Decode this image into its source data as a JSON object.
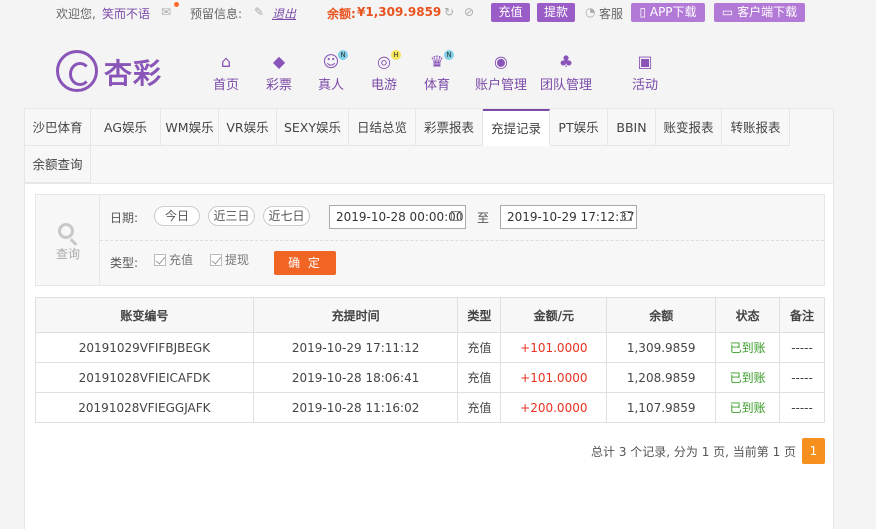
{
  "topbar": {
    "welcome": "欢迎您,",
    "username": "笑而不语",
    "reserved_info_label": "预留信息:",
    "logout": "退出",
    "balance_label": "余额:",
    "balance_value": "¥1,309.9859",
    "recharge": "充值",
    "withdraw": "提款",
    "service": "客服",
    "app_download": "APP下载",
    "client_download": "客户端下载"
  },
  "logo": {
    "name": "杏彩"
  },
  "nav": [
    {
      "label": "首页",
      "icon": "home-icon",
      "glyph": "⌂",
      "badge": ""
    },
    {
      "label": "彩票",
      "icon": "ticket-icon",
      "glyph": "◆",
      "badge": ""
    },
    {
      "label": "真人",
      "icon": "dealer-icon",
      "glyph": "☺",
      "badge": "N"
    },
    {
      "label": "电游",
      "icon": "gamepad-icon",
      "glyph": "◎",
      "badge": "H"
    },
    {
      "label": "体育",
      "icon": "trophy-icon",
      "glyph": "♛",
      "badge": "N"
    },
    {
      "label": "账户管理",
      "icon": "account-icon",
      "glyph": "◉",
      "badge": ""
    },
    {
      "label": "团队管理",
      "icon": "team-icon",
      "glyph": "♣",
      "badge": ""
    },
    {
      "label": "活动",
      "icon": "gift-icon",
      "glyph": "▣",
      "badge": ""
    }
  ],
  "tabs": [
    "沙巴体育",
    "AG娱乐",
    "WM娱乐",
    "VR娱乐",
    "SEXY娱乐",
    "日结总览",
    "彩票报表",
    "充提记录",
    "PT娱乐",
    "BBIN",
    "账变报表",
    "转账报表",
    "余额查询"
  ],
  "active_tab": "充提记录",
  "filter": {
    "search_label": "查询",
    "date_label": "日期:",
    "quick": [
      "今日",
      "近三日",
      "近七日"
    ],
    "start": "2019-10-28 00:00:00",
    "to": "至",
    "end": "2019-10-29 17:12:37",
    "type_label": "类型:",
    "types": [
      "充值",
      "提现"
    ],
    "confirm": "确 定"
  },
  "table": {
    "headers": [
      "账变编号",
      "充提时间",
      "类型",
      "金额/元",
      "余额",
      "状态",
      "备注"
    ],
    "rows": [
      [
        "20191029VFIFBJBEGK",
        "2019-10-29 17:11:12",
        "充值",
        "+101.0000",
        "1,309.9859",
        "已到账",
        "-----"
      ],
      [
        "20191028VFIEICAFDK",
        "2019-10-28 18:06:41",
        "充值",
        "+101.0000",
        "1,208.9859",
        "已到账",
        "-----"
      ],
      [
        "20191028VFIEGGJAFK",
        "2019-10-28 11:16:02",
        "充值",
        "+200.0000",
        "1,107.9859",
        "已到账",
        "-----"
      ]
    ]
  },
  "pager": {
    "summary": "总计 3 个记录, 分为 1 页, 当前第 1 页",
    "current": "1"
  }
}
